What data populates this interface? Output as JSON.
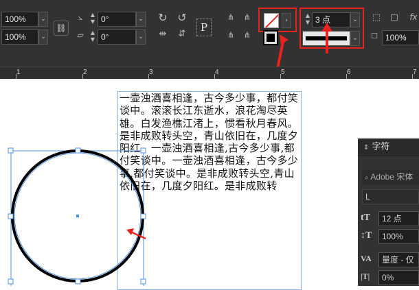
{
  "toolbar": {
    "scale_x": "100%",
    "scale_y": "100%",
    "rotate_angle": "0°",
    "shear_angle": "0°",
    "stroke_weight": "3 点",
    "opacity": "100%",
    "fx_label": "fx",
    "p_label": "P"
  },
  "ruler": {
    "marks": [
      "1",
      "2",
      "3",
      "4",
      "5",
      "6",
      "7"
    ]
  },
  "document": {
    "text": "一壶浊酒喜相逢，古今多少事，都付笑谈中。滚滚长江东逝水，浪花淘尽英雄。白发渔樵江渚上，惯看秋月春风。是非成败转头空，青山依旧在，几度夕阳红。一壶浊酒喜相逢,古今多少事,都付笑谈中。一壶浊酒喜相逢，古今多少事,都付笑谈中。是非成败转头空,青山依旧在，几度夕阳红。是非成败转"
  },
  "character_panel": {
    "title": "字符",
    "font_family": "Adobe 宋体",
    "font_style": "L",
    "font_size": "12 点",
    "vertical_scale": "100%",
    "kerning": "量度 - 仅",
    "tracking": "0%"
  },
  "colors": {
    "highlight_red": "#e8231f",
    "selection_blue": "#4a90e2",
    "ui_dark": "#323232"
  }
}
